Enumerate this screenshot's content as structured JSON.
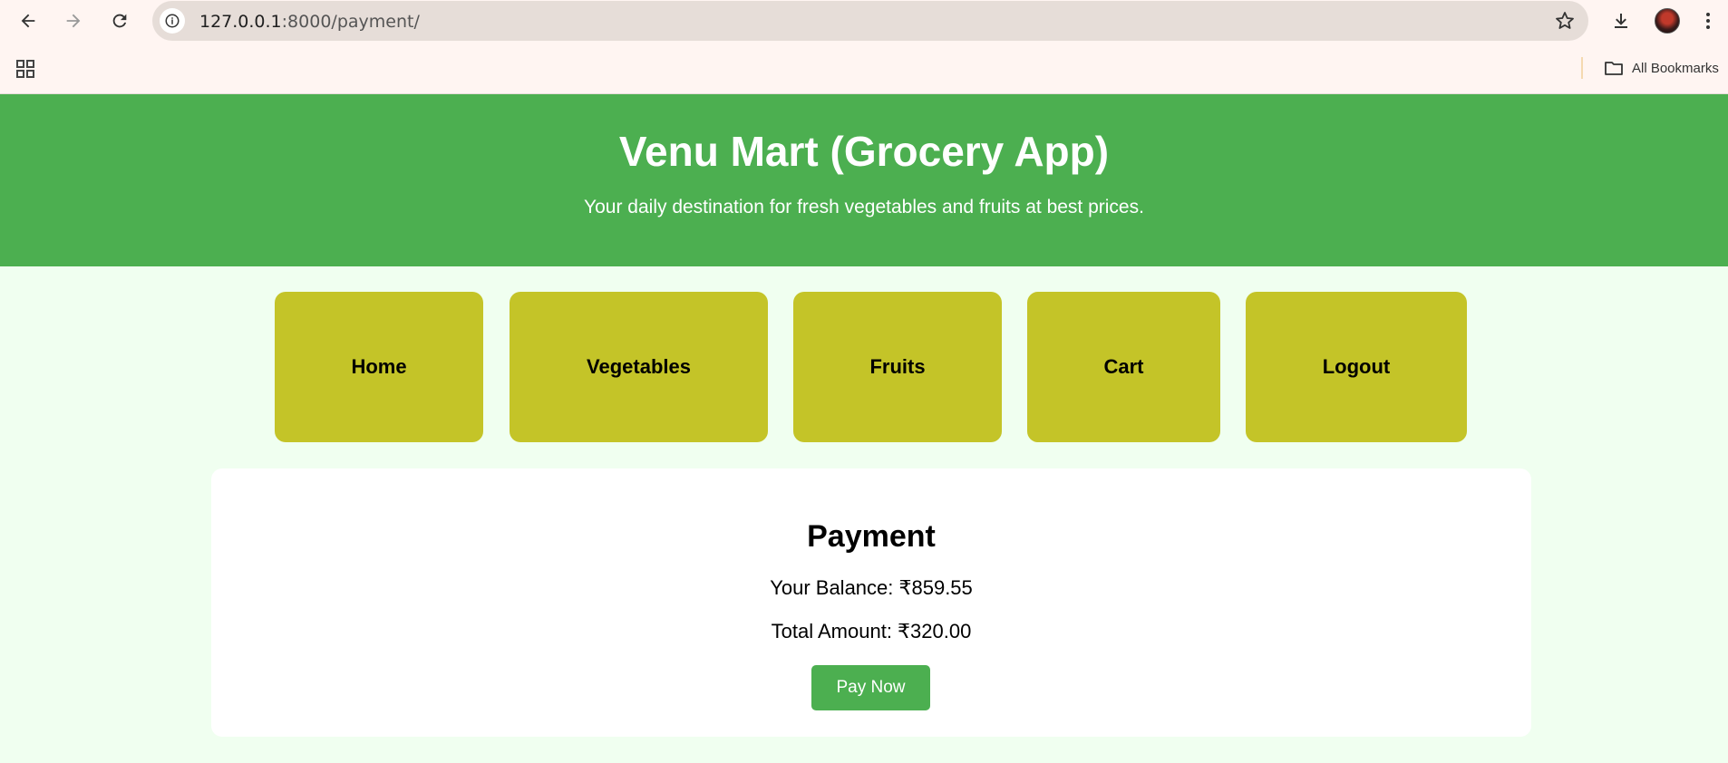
{
  "browser": {
    "url_host": "127.0.0.1",
    "url_path": ":8000/payment/",
    "bookmarks_label": "All Bookmarks",
    "icons": {
      "back": "back-arrow-icon",
      "forward": "forward-arrow-icon",
      "reload": "reload-icon",
      "site_info": "info-icon",
      "bookmark_star": "star-icon",
      "download": "download-icon",
      "menu": "kebab-menu-icon",
      "apps": "apps-grid-icon",
      "folder": "folder-icon"
    }
  },
  "header": {
    "title": "Venu Mart (Grocery App)",
    "tagline": "Your daily destination for fresh vegetables and fruits at best prices."
  },
  "nav": {
    "items": [
      {
        "label": "Home"
      },
      {
        "label": "Vegetables"
      },
      {
        "label": "Fruits"
      },
      {
        "label": "Cart"
      },
      {
        "label": "Logout"
      }
    ]
  },
  "payment": {
    "title": "Payment",
    "balance": "Your Balance: ₹859.55",
    "total": "Total Amount: ₹320.00",
    "pay_button": "Pay Now"
  },
  "colors": {
    "header_bg": "#4caf50",
    "nav_card_bg": "#c4c428",
    "page_bg": "#f0fff0",
    "pay_button_bg": "#4caf50"
  }
}
